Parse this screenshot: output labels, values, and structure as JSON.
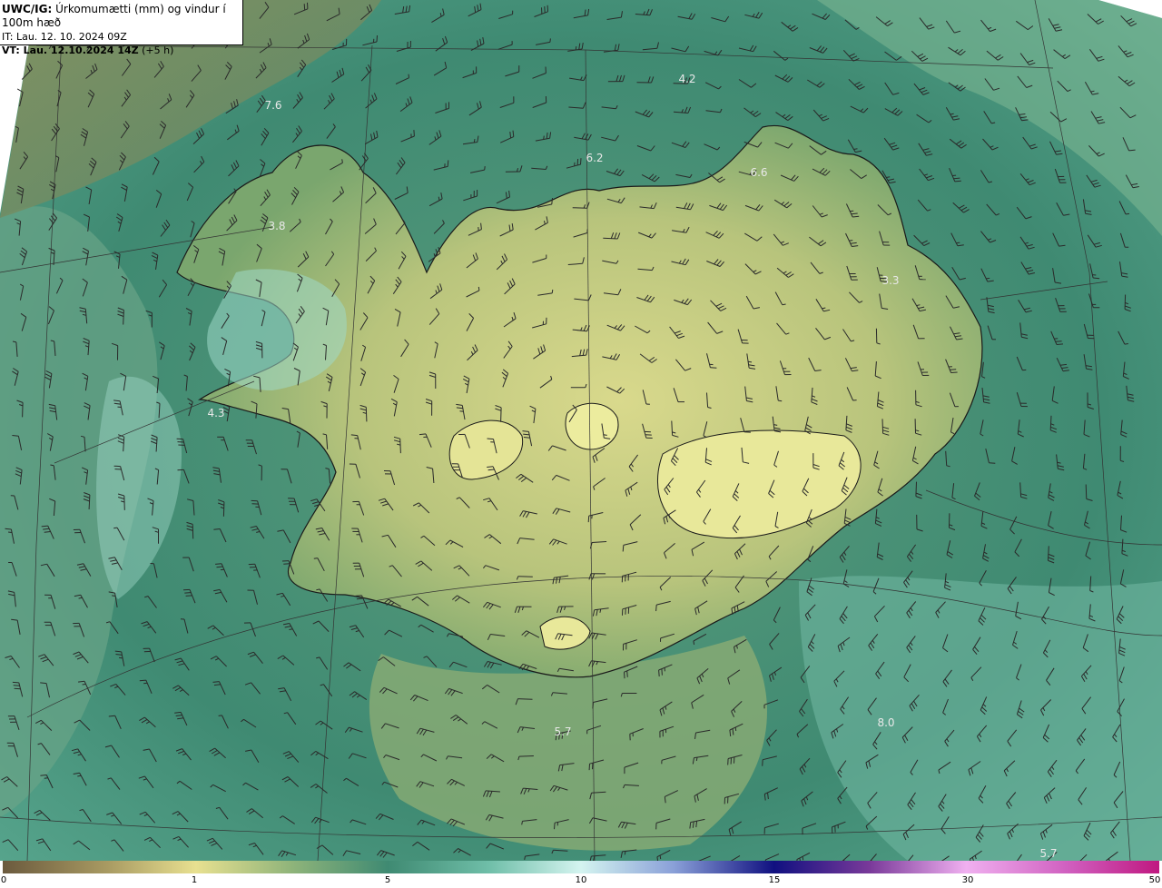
{
  "header": {
    "model": "UWC/IG:",
    "title": "Úrkomumætti (mm) og vindur í 100m hæð",
    "it_line": "IT: Lau. 12. 10. 2024 09Z",
    "vt_prefix": "VT: Lau. 12.10.2024 14Z",
    "vt_suffix": "(+5 h)"
  },
  "value_labels": [
    "4.2",
    "7.6",
    "6.2",
    "6.6",
    "3.8",
    "3.3",
    "4.3",
    "5.7",
    "8.0",
    "5.7"
  ],
  "colorbar": {
    "ticks": [
      "0",
      "1",
      "5",
      "10",
      "15",
      "30",
      "50"
    ]
  },
  "colors": {
    "ocean_dark": "#3f7f6a",
    "ocean_mid": "#4f9a80",
    "land_low": "#7fa66a",
    "land_high": "#d8d88a",
    "glacier": "#e6e69a",
    "precip_light": "#9fd8c8",
    "coastline": "#1a1a1a",
    "gridline": "#333333",
    "wind_barb": "#2a2a2a"
  }
}
